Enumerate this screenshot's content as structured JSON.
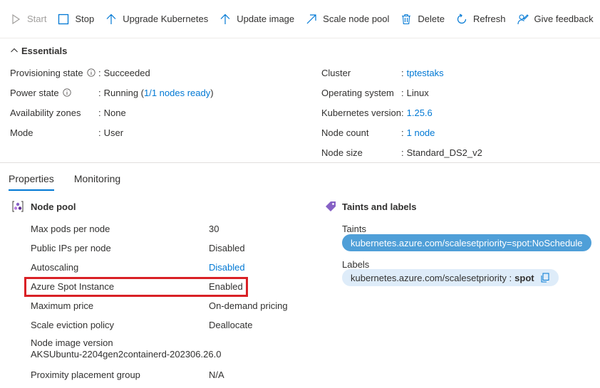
{
  "toolbar": {
    "start": "Start",
    "stop": "Stop",
    "upgrade": "Upgrade Kubernetes",
    "update_image": "Update image",
    "scale": "Scale node pool",
    "delete": "Delete",
    "refresh": "Refresh",
    "feedback": "Give feedback"
  },
  "essentials": {
    "title": "Essentials",
    "left": [
      {
        "label": "Provisioning state",
        "value": "Succeeded"
      },
      {
        "label": "Power state",
        "value_prefix": "Running (",
        "value_link": "1/1 nodes ready",
        "value_suffix": ")"
      },
      {
        "label": "Availability zones",
        "value": "None"
      },
      {
        "label": "Mode",
        "value": "User"
      }
    ],
    "right": [
      {
        "label": "Cluster",
        "value": "tptestaks"
      },
      {
        "label": "Operating system",
        "value": "Linux"
      },
      {
        "label": "Kubernetes version",
        "value": "1.25.6"
      },
      {
        "label": "Node count",
        "value": "1 node"
      },
      {
        "label": "Node size",
        "value": "Standard_DS2_v2"
      }
    ],
    "separator": ":"
  },
  "tabs": {
    "properties": "Properties",
    "monitoring": "Monitoring"
  },
  "node_pool": {
    "title": "Node pool",
    "rows": [
      {
        "label": "Max pods per node",
        "value": "30"
      },
      {
        "label": "Public IPs per node",
        "value": "Disabled"
      },
      {
        "label": "Autoscaling",
        "value": "Disabled"
      },
      {
        "label": "Azure Spot Instance",
        "value": "Enabled"
      },
      {
        "label": "Maximum price",
        "value": "On-demand pricing"
      },
      {
        "label": "Scale eviction policy",
        "value": "Deallocate"
      },
      {
        "label_line1": "Node image version",
        "label_line2": "AKSUbuntu-2204gen2containerd-202306.26.0"
      },
      {
        "label": "Proximity placement group",
        "value": "N/A"
      }
    ]
  },
  "taints_labels": {
    "title": "Taints and labels",
    "taints_label": "Taints",
    "taint_value": "kubernetes.azure.com/scalesetpriority=spot:NoSchedule",
    "labels_label": "Labels",
    "label_key": "kubernetes.azure.com/scalesetpriority :",
    "label_value": "spot"
  },
  "colors": {
    "accent": "#0078d4",
    "highlight": "#d92126",
    "taint_pill": "#4f9fd8",
    "label_pill": "#deecf9"
  }
}
